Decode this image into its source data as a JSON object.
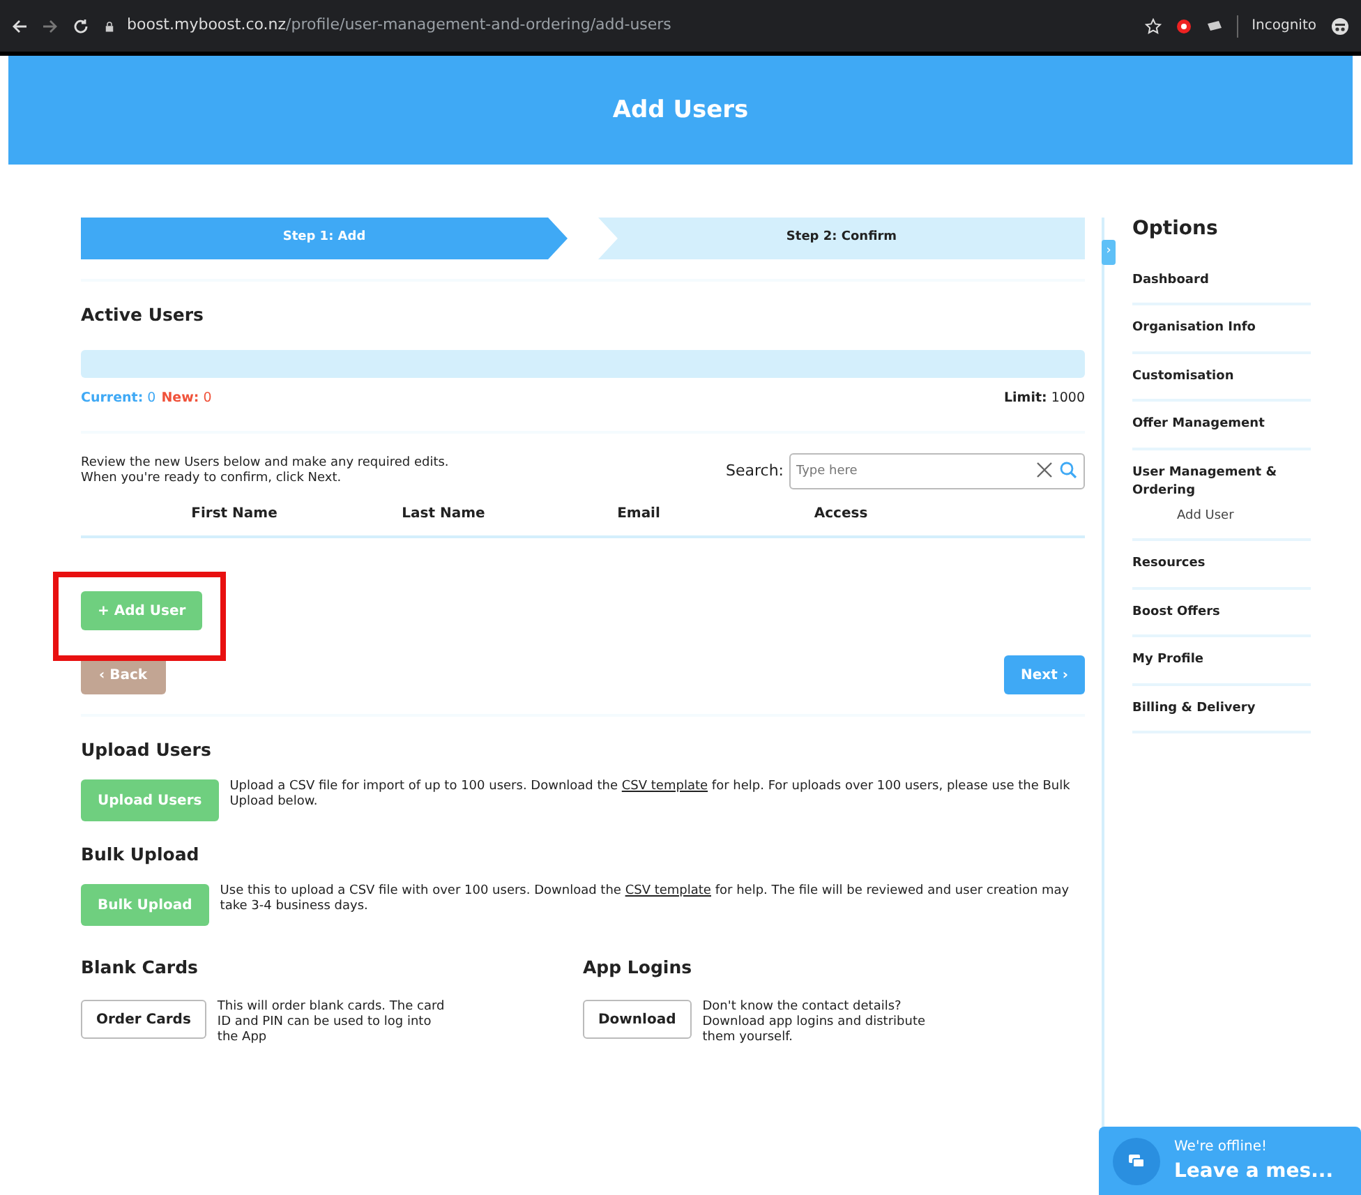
{
  "browser": {
    "url_host": "boost.myboost.co.nz",
    "url_path": "/profile/user-management-and-ordering/add-users",
    "mode": "Incognito"
  },
  "header": {
    "title": "Add Users"
  },
  "steps": [
    {
      "label": "Step 1: Add",
      "selected": true
    },
    {
      "label": "Step 2: Confirm",
      "selected": false
    }
  ],
  "active_users": {
    "title": "Active Users",
    "counts": [
      {
        "label": "Current:",
        "value": "0",
        "color": "#3fa9f5"
      },
      {
        "label": "New:",
        "value": "0",
        "color": "#f0523a"
      }
    ],
    "progress": {
      "level": 0
    },
    "limit_label": "Limit:",
    "limit_value": "1000",
    "instructions": [
      "Review the new Users below and make any required edits.",
      "When you're ready to confirm, click Next."
    ],
    "search": {
      "label": "Search:",
      "placeholder": "Type here"
    },
    "columns": [
      "First Name",
      "Last Name",
      "Email",
      "Access"
    ],
    "add_button": {
      "label": "+ Add User",
      "highlighted": true
    },
    "back_button": "‹ Back",
    "next_button": "Next ›"
  },
  "sections": [
    {
      "title": "Upload Users",
      "button": "Upload Users",
      "text_before": "Upload a CSV file for import of up to 100 users. Download the ",
      "link": "CSV template",
      "text_after": " for help. For uploads over 100 users, please use the Bulk Upload below."
    },
    {
      "title": "Bulk Upload",
      "button": "Bulk Upload",
      "text_before": "Use this to upload a CSV file with over 100 users. Download the ",
      "link": "CSV template",
      "text_after": " for help. The file will be reviewed and user creation may take 3-4 business days."
    }
  ],
  "extras": [
    {
      "title": "Blank Cards",
      "button": "Order Cards",
      "text": "This will order blank cards. The card ID and PIN can be used to log into the App"
    },
    {
      "title": "App Logins",
      "button": "Download",
      "text": "Don't know the contact details? Download app logins and distribute them yourself."
    }
  ],
  "sidebar": {
    "toggle": "›",
    "title": "Options",
    "items": [
      {
        "label": "Dashboard"
      },
      {
        "label": "Organisation Info"
      },
      {
        "label": "Customisation"
      },
      {
        "label": "Offer Management"
      },
      {
        "label": "User Management & Ordering",
        "children": [
          {
            "label": "Add User"
          }
        ]
      },
      {
        "label": "Resources"
      },
      {
        "label": "Boost Offers"
      },
      {
        "label": "My Profile"
      },
      {
        "label": "Billing & Delivery"
      }
    ]
  },
  "chat": {
    "status": "We're offline!",
    "action": "Leave a mes..."
  }
}
